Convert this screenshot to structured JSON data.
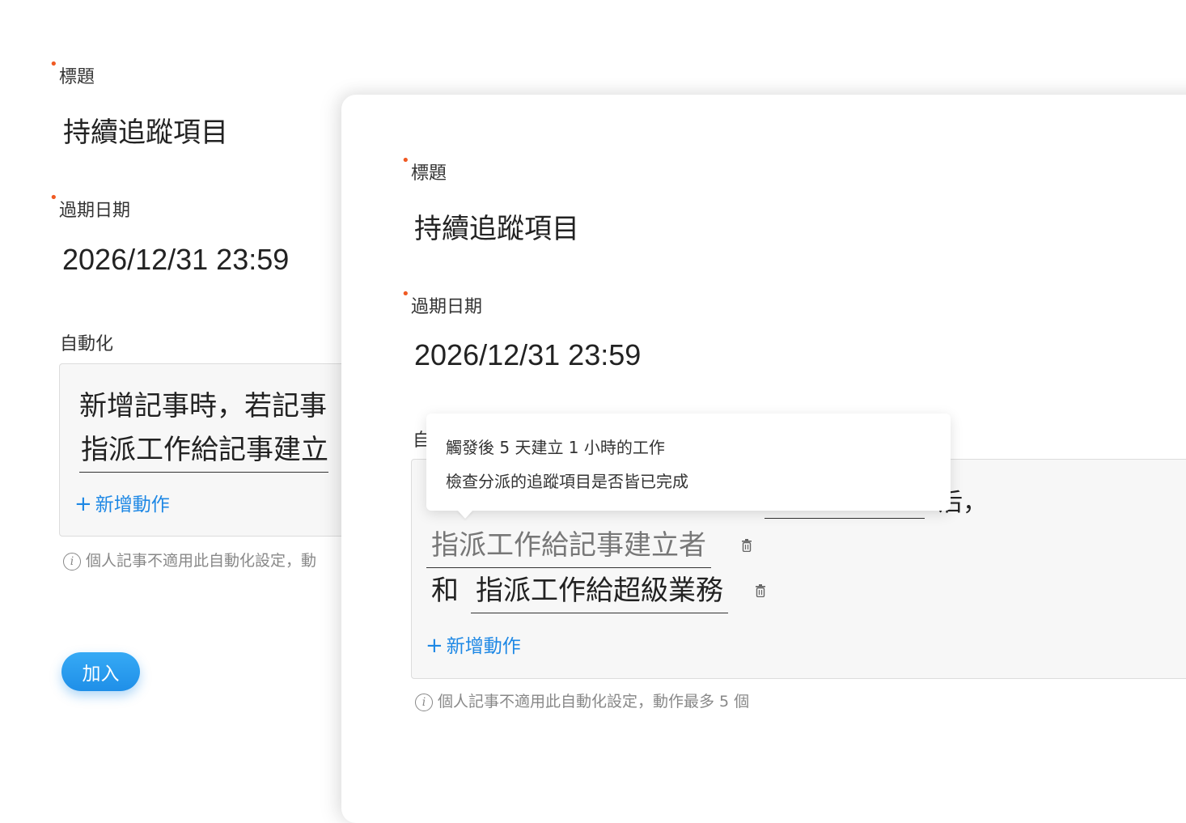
{
  "back_form": {
    "title_label": "標題",
    "title_value": "持續追蹤項目",
    "due_label": "過期日期",
    "due_value": "2026/12/31 23:59",
    "automation_label": "自動化",
    "automation_line1": "新增記事時，若記事",
    "automation_line2": "指派工作給記事建立",
    "add_action": "新增動作",
    "hint": "個人記事不適用此自動化設定，動",
    "join_button": "加入"
  },
  "front_form": {
    "title_label": "標題",
    "title_value": "持續追蹤項目",
    "due_label": "過期日期",
    "due_value": "2026/12/31 23:59",
    "automation_label_partial": "自",
    "automation_fragment": "后，",
    "action1": "指派工作給記事建立者",
    "connector": "和",
    "action2": "指派工作給超級業務",
    "add_action": "新增動作",
    "hint": "個人記事不適用此自動化設定，動作最多 5 個"
  },
  "tooltip": {
    "line1": "觸發後 5 天建立 1 小時的工作",
    "line2": "檢查分派的追蹤項目是否皆已完成"
  },
  "colors": {
    "required_dot": "#f05a23",
    "accent": "#1e88e5",
    "button": "#1f8fe8"
  },
  "icons": {
    "trash": "trash-icon",
    "info": "info-icon",
    "plus": "plus-icon"
  }
}
